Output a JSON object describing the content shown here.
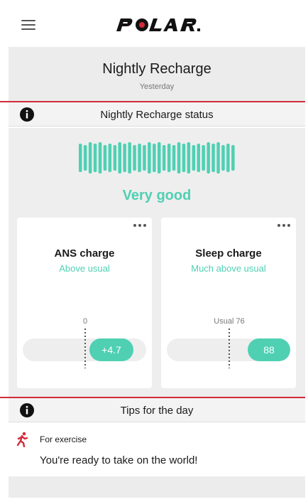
{
  "app": {
    "logo_text": "POLAR."
  },
  "header": {
    "title": "Nightly Recharge",
    "subtitle": "Yesterday"
  },
  "status_section": {
    "title": "Nightly Recharge status"
  },
  "status": {
    "rating": "Very good",
    "accent_color": "#4fd0b3",
    "bar_count": 32
  },
  "cards": {
    "ans": {
      "title": "ANS charge",
      "subtitle": "Above usual",
      "scale_label": "0",
      "value": "+4.7"
    },
    "sleep": {
      "title": "Sleep charge",
      "subtitle": "Much above usual",
      "scale_label": "Usual 76",
      "value": "88"
    }
  },
  "tips_section": {
    "title": "Tips for the day"
  },
  "tips": {
    "category": "For exercise",
    "text": "You're ready to take on the world!"
  },
  "icons": {
    "menu": "hamburger-icon",
    "info": "info-icon",
    "more": "more-dots-icon",
    "exercise": "runner-icon"
  },
  "colors": {
    "brand_red": "#d22b3a",
    "accent": "#4fd0b3"
  }
}
